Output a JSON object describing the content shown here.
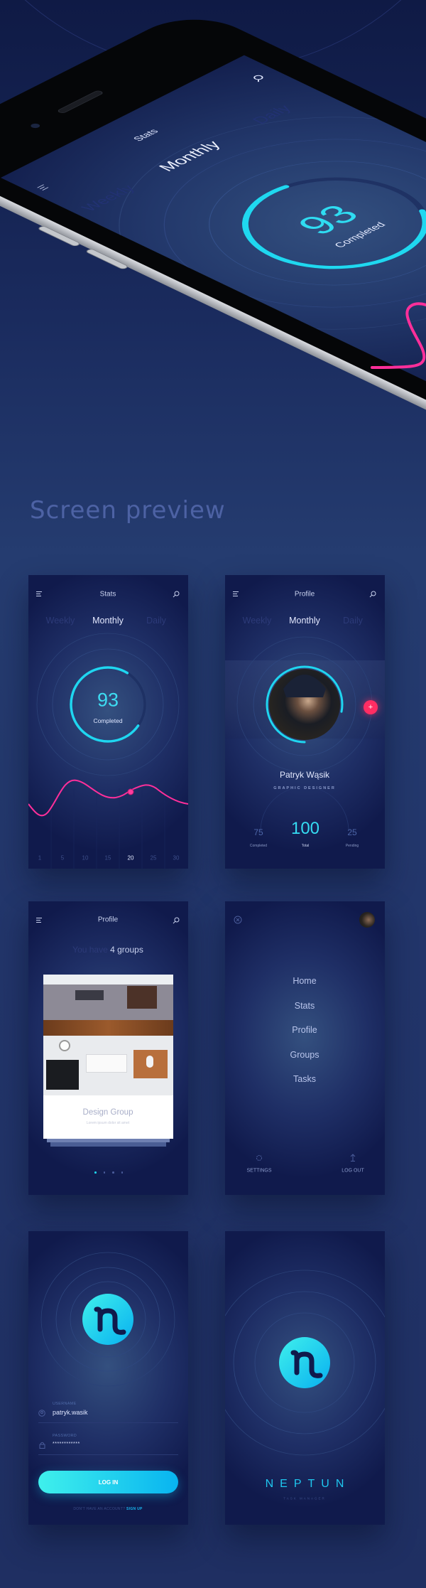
{
  "colors": {
    "accent_cyan": "#1fd3f0",
    "accent_pink": "#ff2f9a",
    "add_button": "#ff2d63",
    "background": "#1c2a58"
  },
  "hero": {
    "title": "Stats",
    "tabs": [
      "Weekly",
      "Monthly",
      "Daily"
    ],
    "active_tab": "Monthly",
    "value": "93",
    "value_label": "Completed",
    "ring_fill": 0.7,
    "icons": [
      "menu-icon",
      "search-icon"
    ]
  },
  "section_title": "Screen preview",
  "stats_screen": {
    "title": "Stats",
    "tabs": [
      "Weekly",
      "Monthly",
      "Daily"
    ],
    "active_tab": "Monthly",
    "value": "93",
    "value_label": "Completed",
    "ring_fill": 0.74,
    "x_labels": [
      "1",
      "5",
      "10",
      "15",
      "20",
      "25",
      "30"
    ],
    "active_x": "20"
  },
  "profile_screen": {
    "title": "Profile",
    "tabs": [
      "Weekly",
      "Monthly",
      "Daily"
    ],
    "active_tab": "Monthly",
    "name": "Patryk Wąsik",
    "role": "GRAPHIC DESIGNER",
    "ring_fill": 0.78,
    "add_label": "+",
    "stats": [
      {
        "value": "75",
        "label": "Completed"
      },
      {
        "value": "100",
        "label": "Total"
      },
      {
        "value": "25",
        "label": "Pending"
      }
    ]
  },
  "groups_screen": {
    "title": "Profile",
    "intro_prefix": "You have",
    "intro_count": "4 groups",
    "card_title": "Design Group",
    "card_subtitle": "Lorem ipsum dolor sit amet",
    "page_count": 4,
    "active_page": 0
  },
  "menu_screen": {
    "items": [
      "Home",
      "Stats",
      "Profile",
      "Groups",
      "Tasks"
    ],
    "settings": "SETTINGS",
    "logout": "LOG OUT"
  },
  "login_screen": {
    "username_label": "USERNAME",
    "username": "patryk.wasik",
    "password_label": "PASSWORD",
    "password": "************",
    "button": "LOG IN",
    "signup_prompt": "DON'T HAVE AN ACCOUNT?",
    "signup_link": "SIGN UP"
  },
  "splash_screen": {
    "brand": "NEPTUN",
    "tagline": "TASK MANAGER"
  }
}
